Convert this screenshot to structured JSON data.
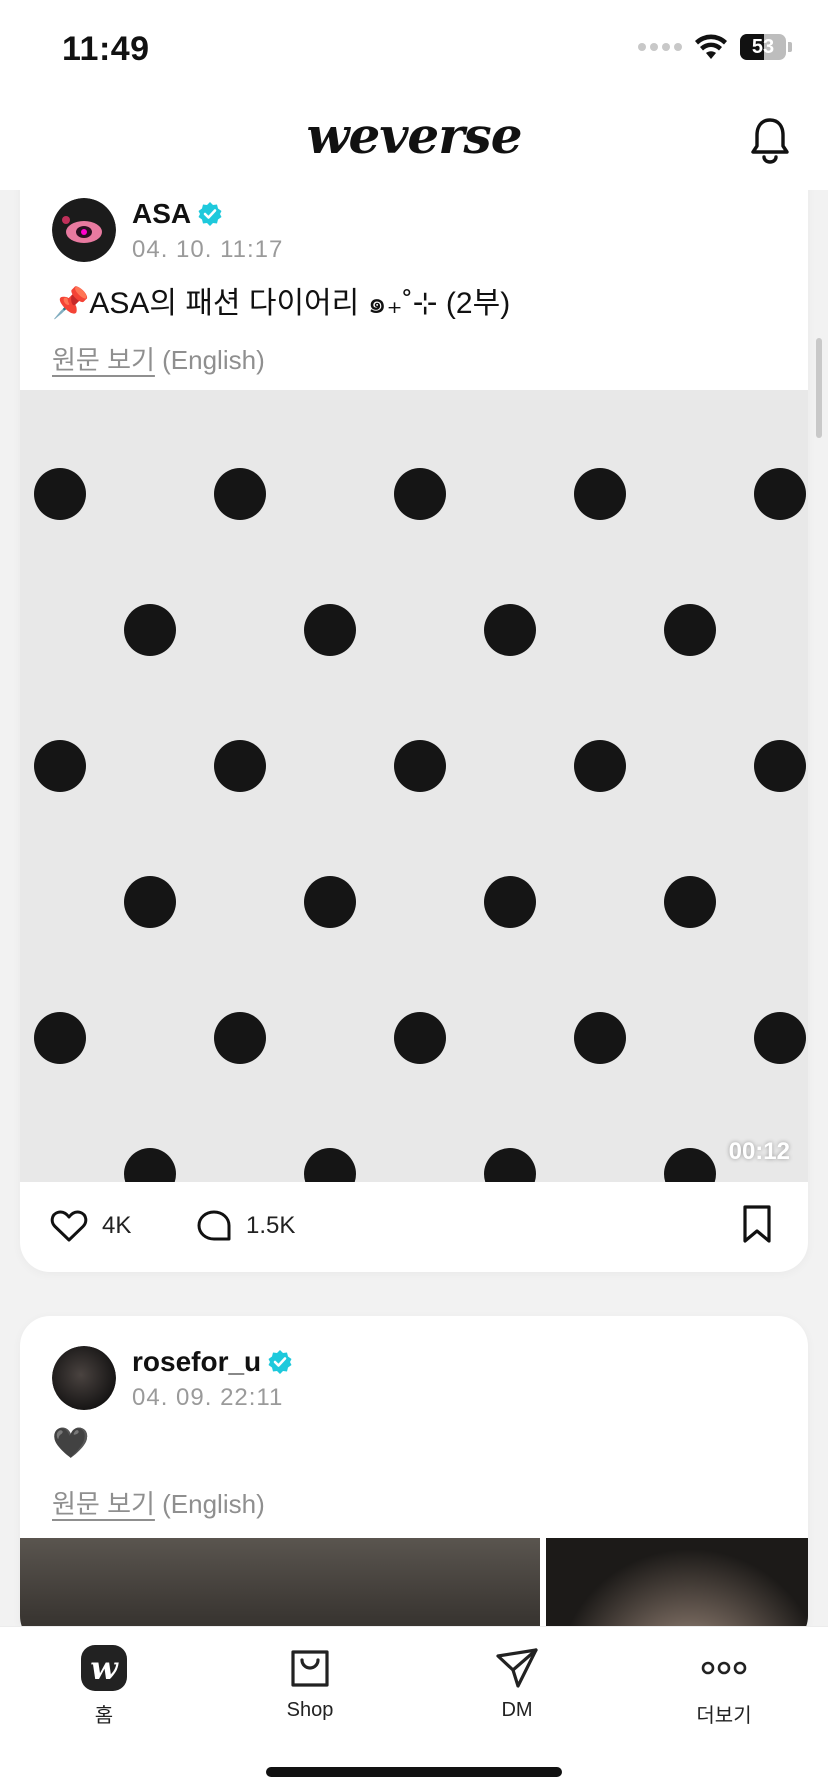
{
  "status_bar": {
    "time": "11:49",
    "battery": "53",
    "battery_level": 0.53
  },
  "header": {
    "logo": "weverse",
    "notification_icon": "bell-icon"
  },
  "posts": [
    {
      "author": "ASA",
      "date": "04. 10. 11:17",
      "text": "📌ASA의 패션 다이어리 ๑₊˚⊹ (2부)",
      "translate": {
        "link": "원문 보기",
        "lang": "(English)"
      },
      "video": {
        "duration": "00:12"
      },
      "likes": "4K",
      "comments": "1.5K"
    },
    {
      "author": "rosefor_u",
      "date": "04. 09. 22:11",
      "text": "🖤",
      "translate": {
        "link": "원문 보기",
        "lang": "(English)"
      }
    }
  ],
  "tabs": [
    {
      "label": "홈",
      "icon": "home-w-icon"
    },
    {
      "label": "Shop",
      "icon": "shopping-bag-icon"
    },
    {
      "label": "DM",
      "icon": "send-icon"
    },
    {
      "label": "더보기",
      "icon": "more-dots-icon"
    }
  ],
  "colors": {
    "verified": "#1ec9dc",
    "video_bg": "#e8e8e8",
    "dot": "#151515"
  }
}
